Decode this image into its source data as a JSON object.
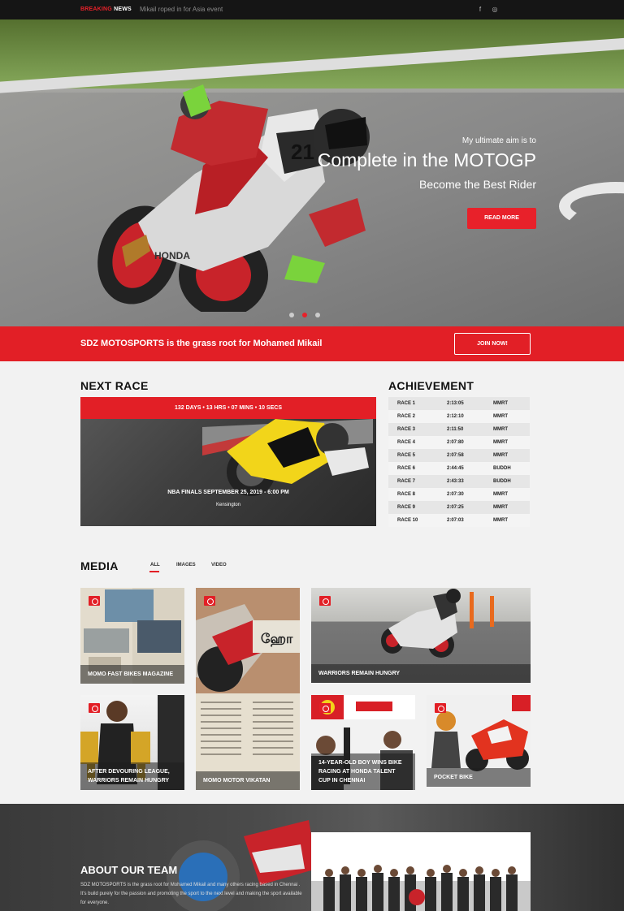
{
  "topbar": {
    "breaking": "BREAKING",
    "news": "NEWS",
    "ticker": "Mikail roped in for Asia event",
    "social": [
      {
        "icon": "facebook-icon",
        "glyph": "f"
      },
      {
        "icon": "instagram-icon",
        "glyph": "◎"
      }
    ]
  },
  "hero": {
    "subtitle": "My ultimate aim is to",
    "title": "Complete in the MOTOGP",
    "tagline": "Become the Best Rider",
    "button": "READ MORE",
    "slides": 3,
    "active_slide": 2
  },
  "strip": {
    "text": "SDZ MOTOSPORTS is the grass root for Mohamed Mikail",
    "button": "JOIN NOW!"
  },
  "next_race": {
    "heading": "NEXT RACE",
    "countdown": "132 DAYS  •  13 HRS  •  07 MINS  •  10 SECS",
    "event": "NBA FINALS SEPTEMBER 25, 2019 - 6:00 PM",
    "location": "Kensington"
  },
  "achievement": {
    "heading": "ACHIEVEMENT",
    "rows": [
      {
        "race": "RACE 1",
        "time": "2:13:05",
        "track": "MMRT"
      },
      {
        "race": "RACE 2",
        "time": "2:12:10",
        "track": "MMRT"
      },
      {
        "race": "RACE 3",
        "time": "2:11:50",
        "track": "MMRT"
      },
      {
        "race": "RACE 4",
        "time": "2:07:80",
        "track": "MMRT"
      },
      {
        "race": "RACE 5",
        "time": "2:07:58",
        "track": "MMRT"
      },
      {
        "race": "RACE 6",
        "time": "2:44:45",
        "track": "BUDDH"
      },
      {
        "race": "RACE 7",
        "time": "2:43:33",
        "track": "BUDDH"
      },
      {
        "race": "RACE 8",
        "time": "2:07:30",
        "track": "MMRT"
      },
      {
        "race": "RACE 9",
        "time": "2:07:25",
        "track": "MMRT"
      },
      {
        "race": "RACE 10",
        "time": "2:07:03",
        "track": "MMRT"
      }
    ]
  },
  "media": {
    "heading": "MEDIA",
    "tabs": [
      "ALL",
      "IMAGES",
      "VIDEO"
    ],
    "active_tab": "ALL",
    "cards": [
      {
        "caption": "MOMO FAST BIKES MAGAZINE",
        "icon": "camera-icon"
      },
      {
        "caption": "MOMO MOTOR VIKATAN",
        "icon": "camera-icon"
      },
      {
        "caption": "WARRIORS REMAIN HUNGRY",
        "icon": "camera-icon"
      },
      {
        "caption": "AFTER DEVOURING LEAGUE, WARRIORS REMAIN HUNGRY",
        "icon": "camera-icon"
      },
      {
        "caption": "14-YEAR-OLD BOY WINS BIKE RACING AT HONDA TALENT CUP IN CHENNAI",
        "icon": "video-icon"
      },
      {
        "caption": "POCKET BIKE",
        "icon": "video-icon"
      }
    ]
  },
  "about": {
    "heading": "ABOUT OUR TEAM",
    "text": "SDZ MOTOSPORTS is the grass root for Mohamed Mikail and many others racing based in Chennai . It's build purely for the passion and promoting the sport to the next level and making the sport available for everyone."
  },
  "colors": {
    "accent": "#e21f26",
    "dark": "#151515",
    "background": "#f2f2f2"
  }
}
